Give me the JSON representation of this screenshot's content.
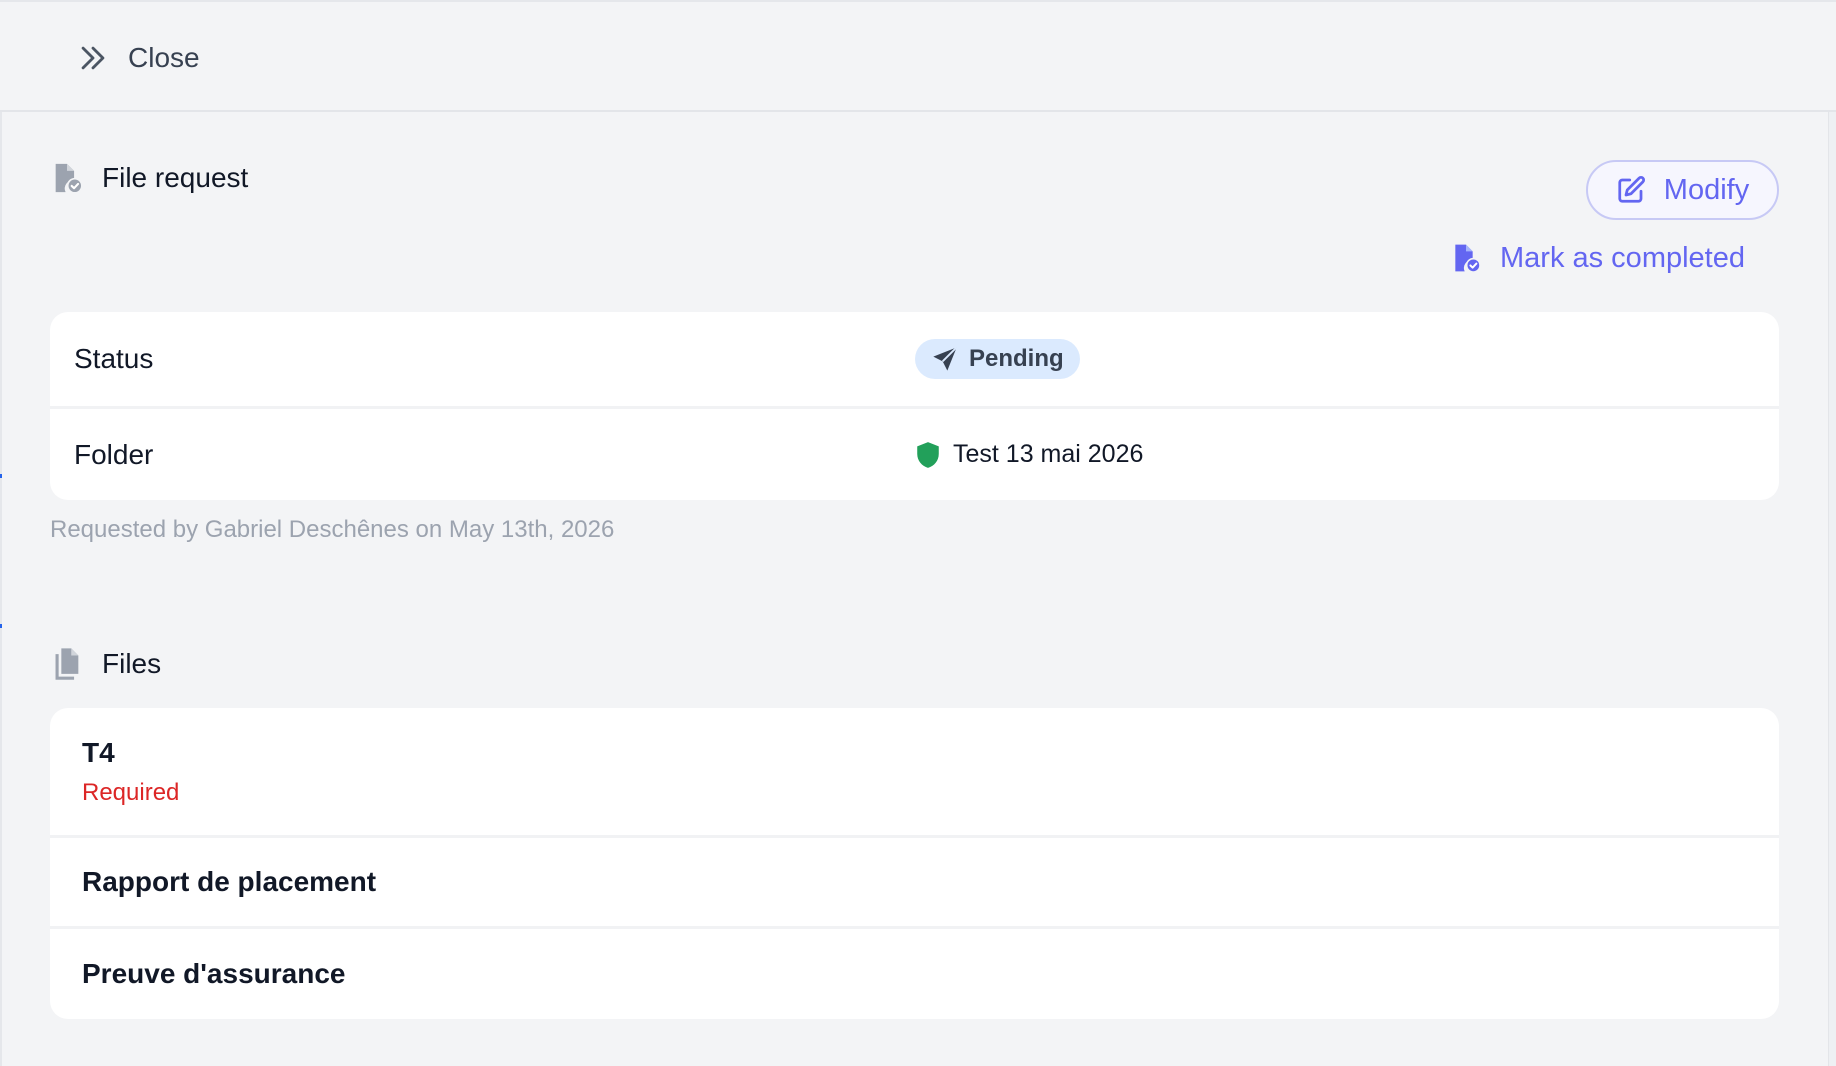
{
  "topbar": {
    "close_label": "Close",
    "close_icon": "chevrons-right-icon"
  },
  "request": {
    "title": "File request",
    "title_icon": "file-check-icon",
    "modify_label": "Modify",
    "modify_icon": "edit-icon",
    "mark_completed_label": "Mark as completed",
    "mark_completed_icon": "file-check-icon",
    "accent_color": "#6366f1",
    "status_label": "Status",
    "status_value": "Pending",
    "status_icon": "paper-plane-icon",
    "folder_label": "Folder",
    "folder_value": "Test 13 mai 2026",
    "folder_icon": "shield-icon",
    "folder_icon_color": "#22a05a",
    "requested_by": "Requested by Gabriel Deschênes on May 13th, 2026"
  },
  "files": {
    "title": "Files",
    "title_icon": "documents-icon",
    "items": [
      {
        "name": "T4",
        "note": "Required"
      },
      {
        "name": "Rapport de placement",
        "note": ""
      },
      {
        "name": "Preuve d'assurance",
        "note": ""
      }
    ],
    "required_color": "#dc2626"
  }
}
